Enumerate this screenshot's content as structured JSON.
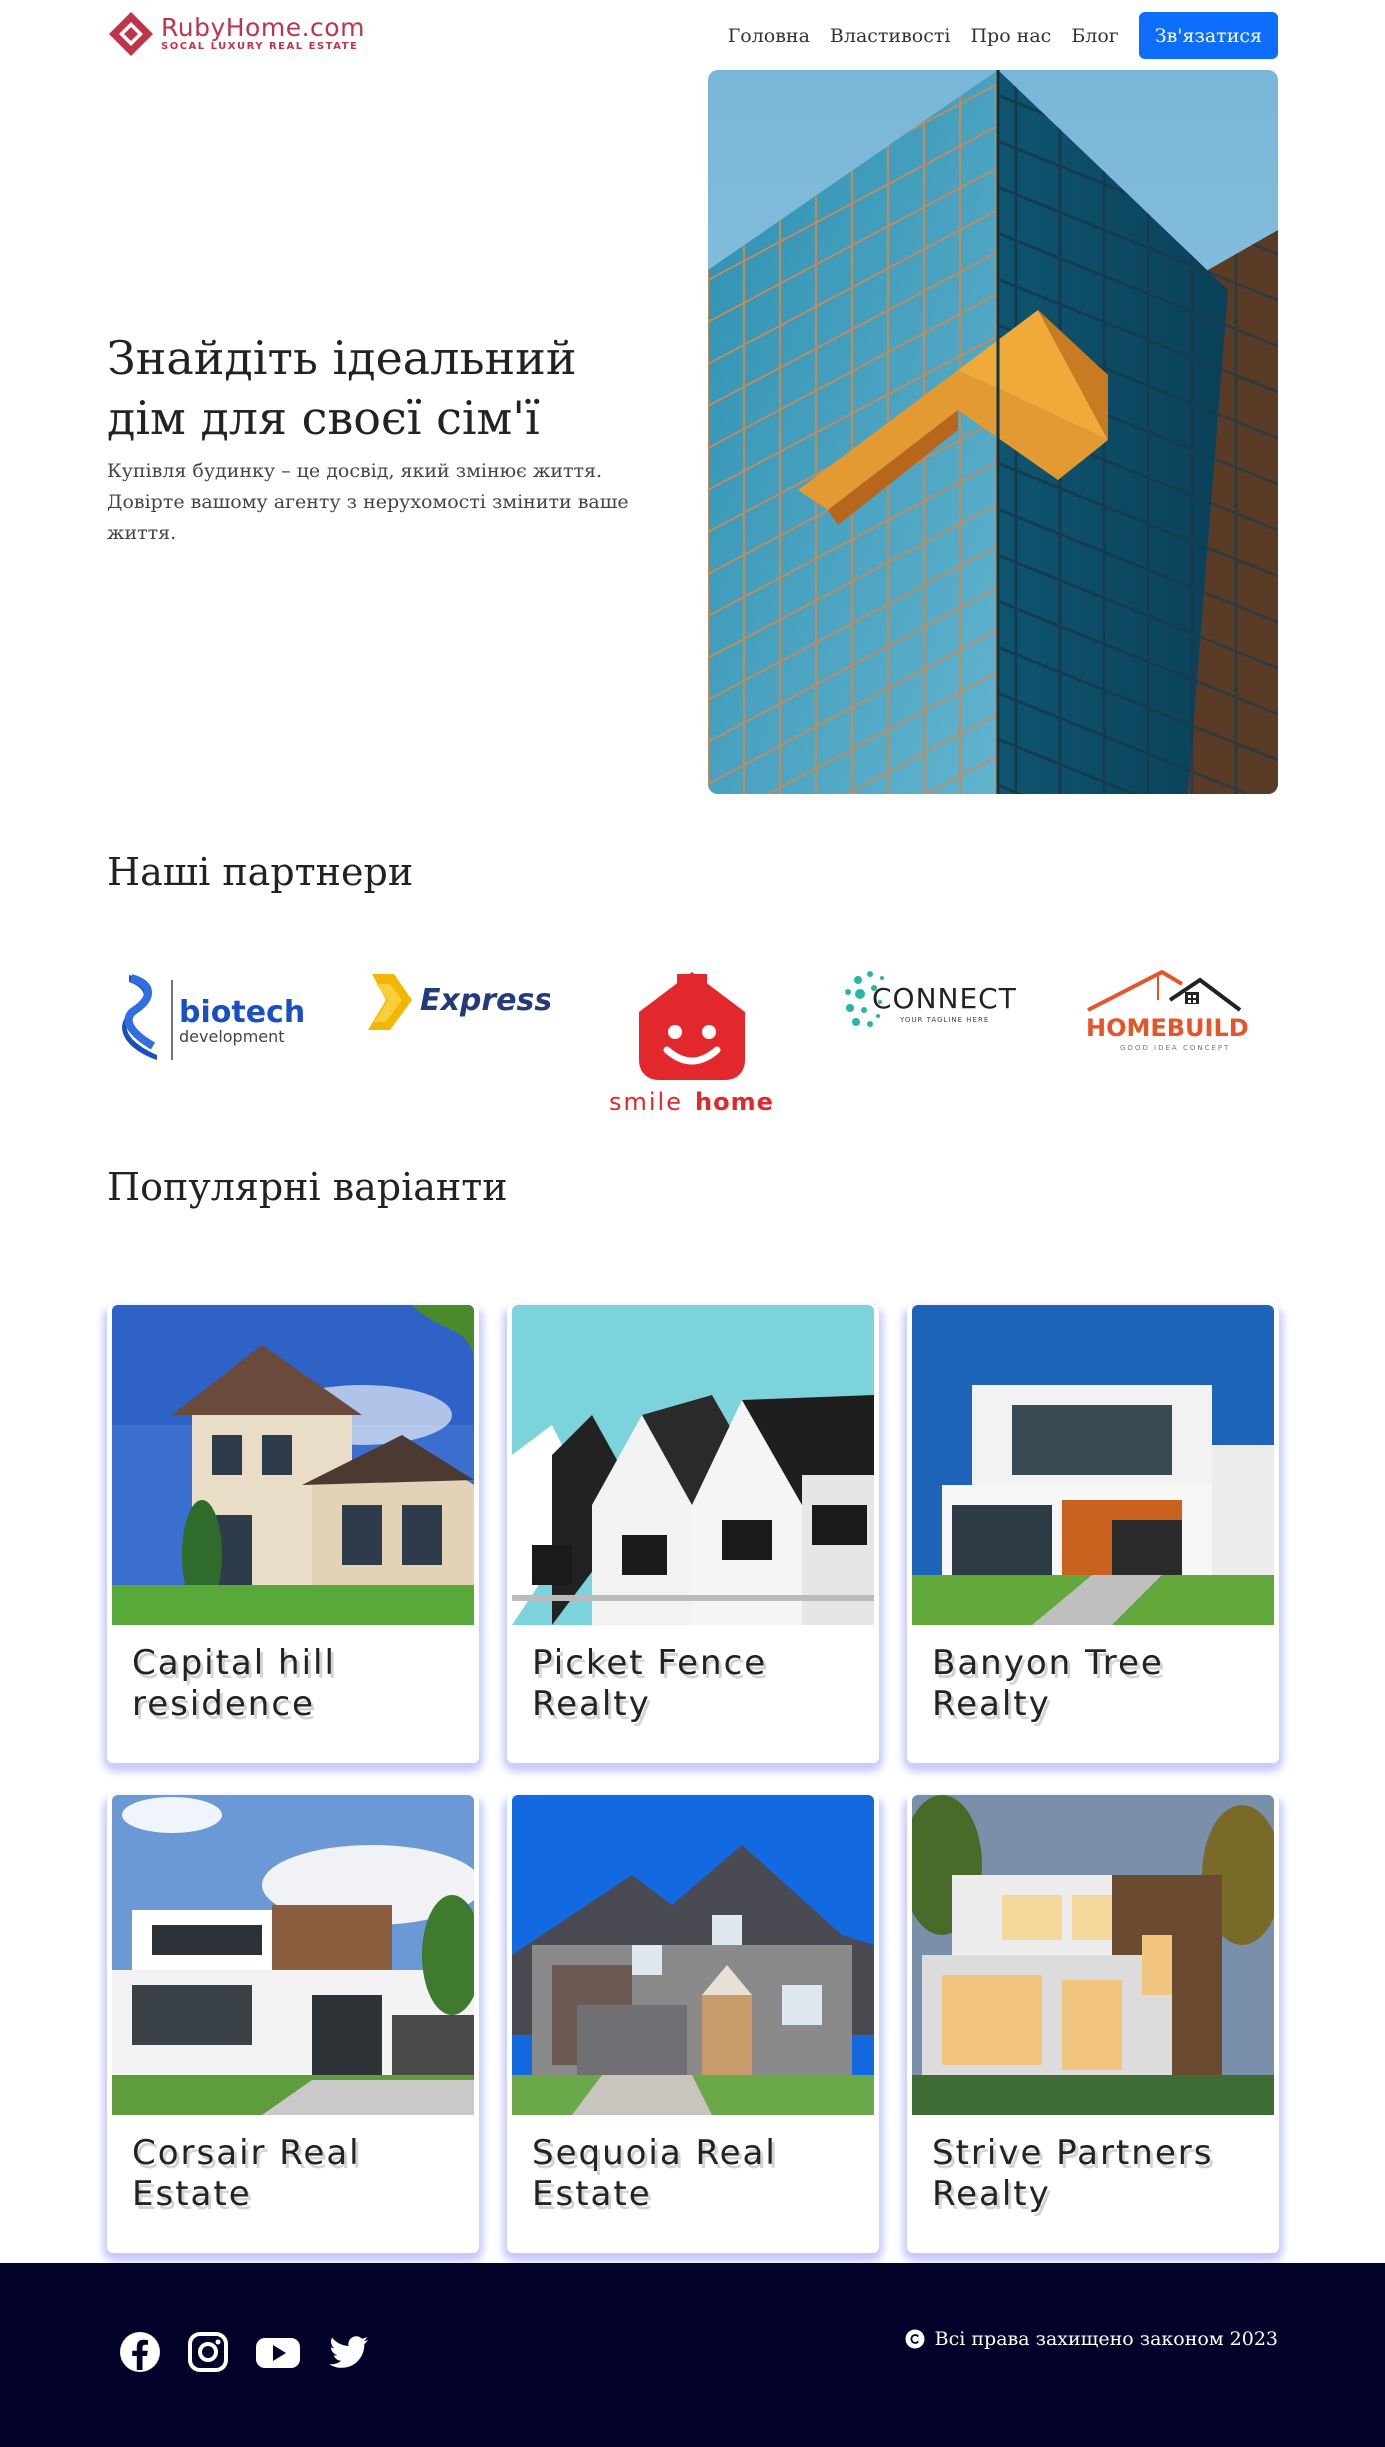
{
  "brand": {
    "name": "RubyHome.com",
    "tagline": "SOCAL LUXURY REAL ESTATE",
    "color": "#c0344a"
  },
  "nav": {
    "items": [
      "Головна",
      "Властивості",
      "Про нас",
      "Блог"
    ],
    "contact_label": "Зв'язатися",
    "contact_color": "#0d6efd"
  },
  "hero": {
    "title": "Знайдіть ідеальний дім для своєї сім'ї",
    "subtitle": "Купівля будинку – це досвід, який змінює життя. Довірте вашому агенту з нерухомості змінити ваше життя."
  },
  "partners": {
    "title": "Наші партнери",
    "logos": [
      {
        "icon": "biotech-logo",
        "text1": "biotech",
        "text2": "development"
      },
      {
        "icon": "express-logo",
        "text1": "Express"
      },
      {
        "icon": "smilehome-logo",
        "text1": "smile",
        "text2": "home"
      },
      {
        "icon": "connect-logo",
        "text1": "CONNECT",
        "text2": "YOUR TAGLINE HERE"
      },
      {
        "icon": "homebuild-logo",
        "text1": "HOMEBUILD",
        "text2": "GOOD IDEA CONCEPT"
      }
    ]
  },
  "popular": {
    "title": "Популярні варіанти",
    "cards": [
      {
        "title": "Capital hill residence"
      },
      {
        "title": "Picket Fence Realty"
      },
      {
        "title": "Banyon Tree Realty"
      },
      {
        "title": "Corsair Real Estate"
      },
      {
        "title": "Sequoia Real Estate"
      },
      {
        "title": "Strive Partners Realty"
      }
    ]
  },
  "footer": {
    "social": [
      "facebook-icon",
      "instagram-icon",
      "youtube-icon",
      "twitter-icon"
    ],
    "copyright": "Всі права захищено законом 2023",
    "background": "#02022a"
  }
}
